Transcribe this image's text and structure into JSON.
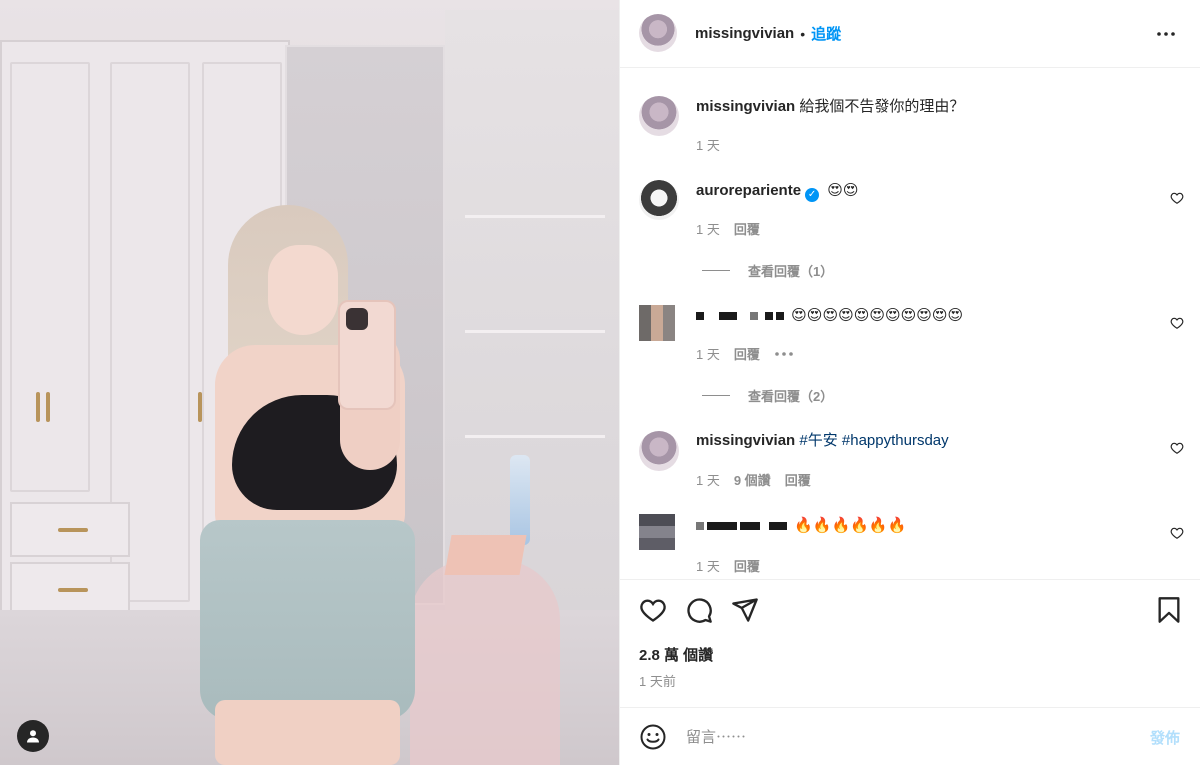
{
  "header": {
    "username": "missingvivian",
    "separator": "•",
    "follow_label": "追蹤",
    "more_icon": "more-horizontal-icon"
  },
  "comments": {
    "caption": {
      "username": "missingvivian",
      "text": "給我個不告發你的理由？",
      "time": "1 天"
    },
    "c1": {
      "username": "auroreparienteverified",
      "username_display": "aurorepariente",
      "text": "😍😍",
      "time": "1 天",
      "reply": "回覆",
      "view_replies": "查看回覆（1）"
    },
    "c2": {
      "text": "😍😍😍😍😍😍😍😍😍😍😍",
      "time": "1 天",
      "reply": "回覆",
      "view_replies": "查看回覆（2）"
    },
    "c3": {
      "username": "missingvivian",
      "hashtag1": "#午安",
      "hashtag2": "#happythursday",
      "time": "1 天",
      "likes": "9 個讚",
      "reply": "回覆"
    },
    "c4": {
      "text": "🔥🔥🔥🔥🔥🔥",
      "time": "1 天",
      "reply": "回覆"
    }
  },
  "actions": {
    "likes": "2.8 萬 個讚",
    "posted": "1 天前"
  },
  "composer": {
    "placeholder": "留言⋯⋯",
    "post_label": "發佈"
  },
  "colors": {
    "accent": "#0095f6",
    "post_disabled": "#b2dffc",
    "hashtag": "#00376b",
    "muted": "#8e8e8e"
  }
}
